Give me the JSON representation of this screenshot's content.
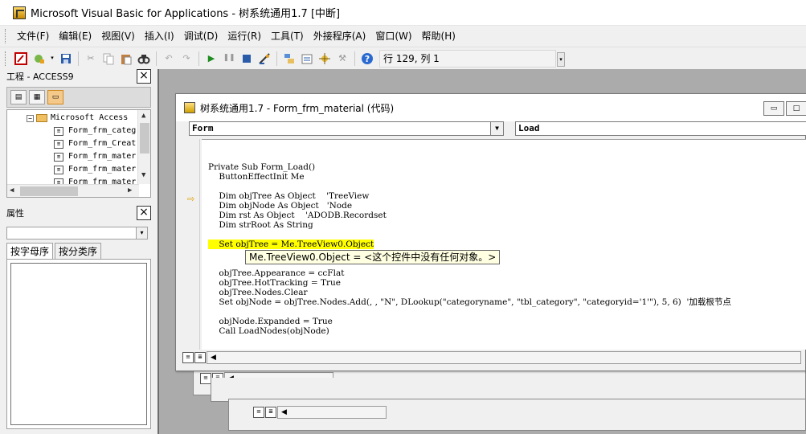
{
  "app": {
    "title": "Microsoft Visual Basic for Applications - 树系统通用1.7 [中断]"
  },
  "menu": {
    "items": [
      "文件(F)",
      "编辑(E)",
      "视图(V)",
      "插入(I)",
      "调试(D)",
      "运行(R)",
      "工具(T)",
      "外接程序(A)",
      "窗口(W)",
      "帮助(H)"
    ]
  },
  "toolbar": {
    "status": "行 129, 列 1"
  },
  "project_panel": {
    "title": "工程 - ACCESS9",
    "close_label": "×",
    "root": "Microsoft Access",
    "items": [
      "Form_frm_categ",
      "Form_frm_Creat",
      "Form_frm_mater",
      "Form_frm_mater",
      "Form_frm_mater"
    ]
  },
  "properties_panel": {
    "title": "属性",
    "close_label": "×",
    "tabs": [
      "按字母序",
      "按分类序"
    ]
  },
  "code_window": {
    "title": "树系统通用1.7 - Form_frm_material (代码)",
    "object_combo": "Form",
    "proc_combo": "Load",
    "tooltip": "Me.TreeView0.Object = <这个控件中没有任何对象。>",
    "lines": [
      "Private Sub Form_Load()",
      "    ButtonEffectInit Me",
      "",
      "    Dim objTree As Object    'TreeView",
      "    Dim objNode As Object   'Node",
      "    Dim rst As Object    'ADODB.Recordset",
      "    Dim strRoot As String",
      "",
      "    Set objTree = Me.TreeView0.Object",
      "",
      "    objTree.Appearance = ccFlat",
      "    objTree.HotTracking = True",
      "    objTree.Nodes.Clear",
      "    Set objNode = objTree.Nodes.Add(, , \"N\", DLookup(\"categoryname\", \"tbl_category\", \"categoryid='1'\"), 5, 6)  '加载根节点",
      "",
      "    objNode.Expanded = True",
      "    Call LoadNodes(objNode)"
    ]
  },
  "colors": {
    "highlight": "#ffff00",
    "tooltip_bg": "#ffffe1",
    "mdi_bg": "#ababab"
  }
}
